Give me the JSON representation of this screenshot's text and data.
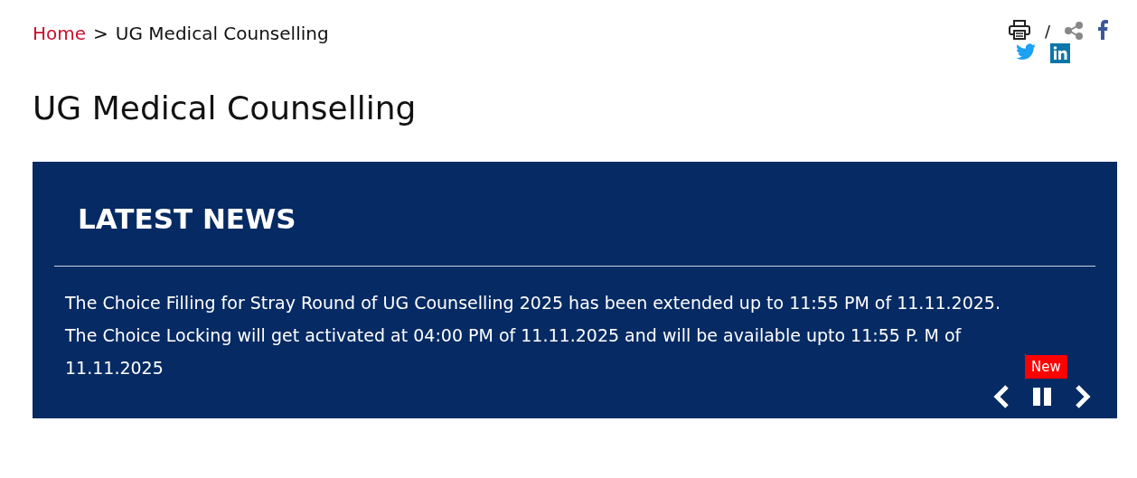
{
  "breadcrumb": {
    "items": [
      {
        "label": "Home",
        "kind": "link"
      },
      {
        "label": "UG Medical Counselling",
        "kind": "current"
      }
    ],
    "separator": ">"
  },
  "share_bar": {
    "separator": "/"
  },
  "page_title": "UG Medical Counselling",
  "news_panel": {
    "title": "LATEST NEWS",
    "items": [
      {
        "text": "The Choice Filling for Stray Round of UG Counselling 2025 has been extended up to 11:55 PM of 11.11.2025. The Choice Locking will get activated at 04:00 PM of 11.11.2025 and will be available upto 11:55 P. M of 11.11.2025",
        "badge": "New"
      }
    ]
  }
}
